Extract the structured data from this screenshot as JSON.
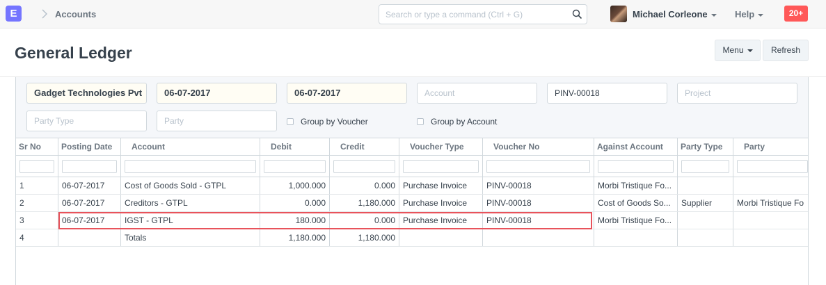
{
  "navbar": {
    "logo": "E",
    "breadcrumb": "Accounts",
    "search_placeholder": "Search or type a command (Ctrl + G)",
    "user": "Michael Corleone",
    "help": "Help",
    "notifications": "20+"
  },
  "page": {
    "title": "General Ledger",
    "menu_label": "Menu",
    "refresh_label": "Refresh"
  },
  "filters": {
    "company": "Gadget Technologies Pvt",
    "from_date": "06-07-2017",
    "to_date": "06-07-2017",
    "account_placeholder": "Account",
    "voucher_no": "PINV-00018",
    "project_placeholder": "Project",
    "party_type_placeholder": "Party Type",
    "party_placeholder": "Party",
    "group_by_voucher": "Group by Voucher",
    "group_by_account": "Group by Account"
  },
  "table": {
    "columns": [
      "Sr No",
      "Posting Date",
      "Account",
      "Debit",
      "Credit",
      "Voucher Type",
      "Voucher No",
      "Against Account",
      "Party Type",
      "Party"
    ],
    "rows": [
      [
        "1",
        "06-07-2017",
        "Cost of Goods Sold - GTPL",
        "1,000.000",
        "0.000",
        "Purchase Invoice",
        "PINV-00018",
        "Morbi Tristique Fo...",
        "",
        ""
      ],
      [
        "2",
        "06-07-2017",
        "Creditors - GTPL",
        "0.000",
        "1,180.000",
        "Purchase Invoice",
        "PINV-00018",
        "Cost of Goods So...",
        "Supplier",
        "Morbi Tristique Fo"
      ],
      [
        "3",
        "06-07-2017",
        "IGST - GTPL",
        "180.000",
        "0.000",
        "Purchase Invoice",
        "PINV-00018",
        "Morbi Tristique Fo...",
        "",
        ""
      ],
      [
        "4",
        "",
        "Totals",
        "1,180.000",
        "1,180.000",
        "",
        "",
        "",
        "",
        ""
      ]
    ]
  },
  "colors": {
    "logo": "#7575ff",
    "notification": "#ff5858",
    "highlight": "#e8535b"
  }
}
